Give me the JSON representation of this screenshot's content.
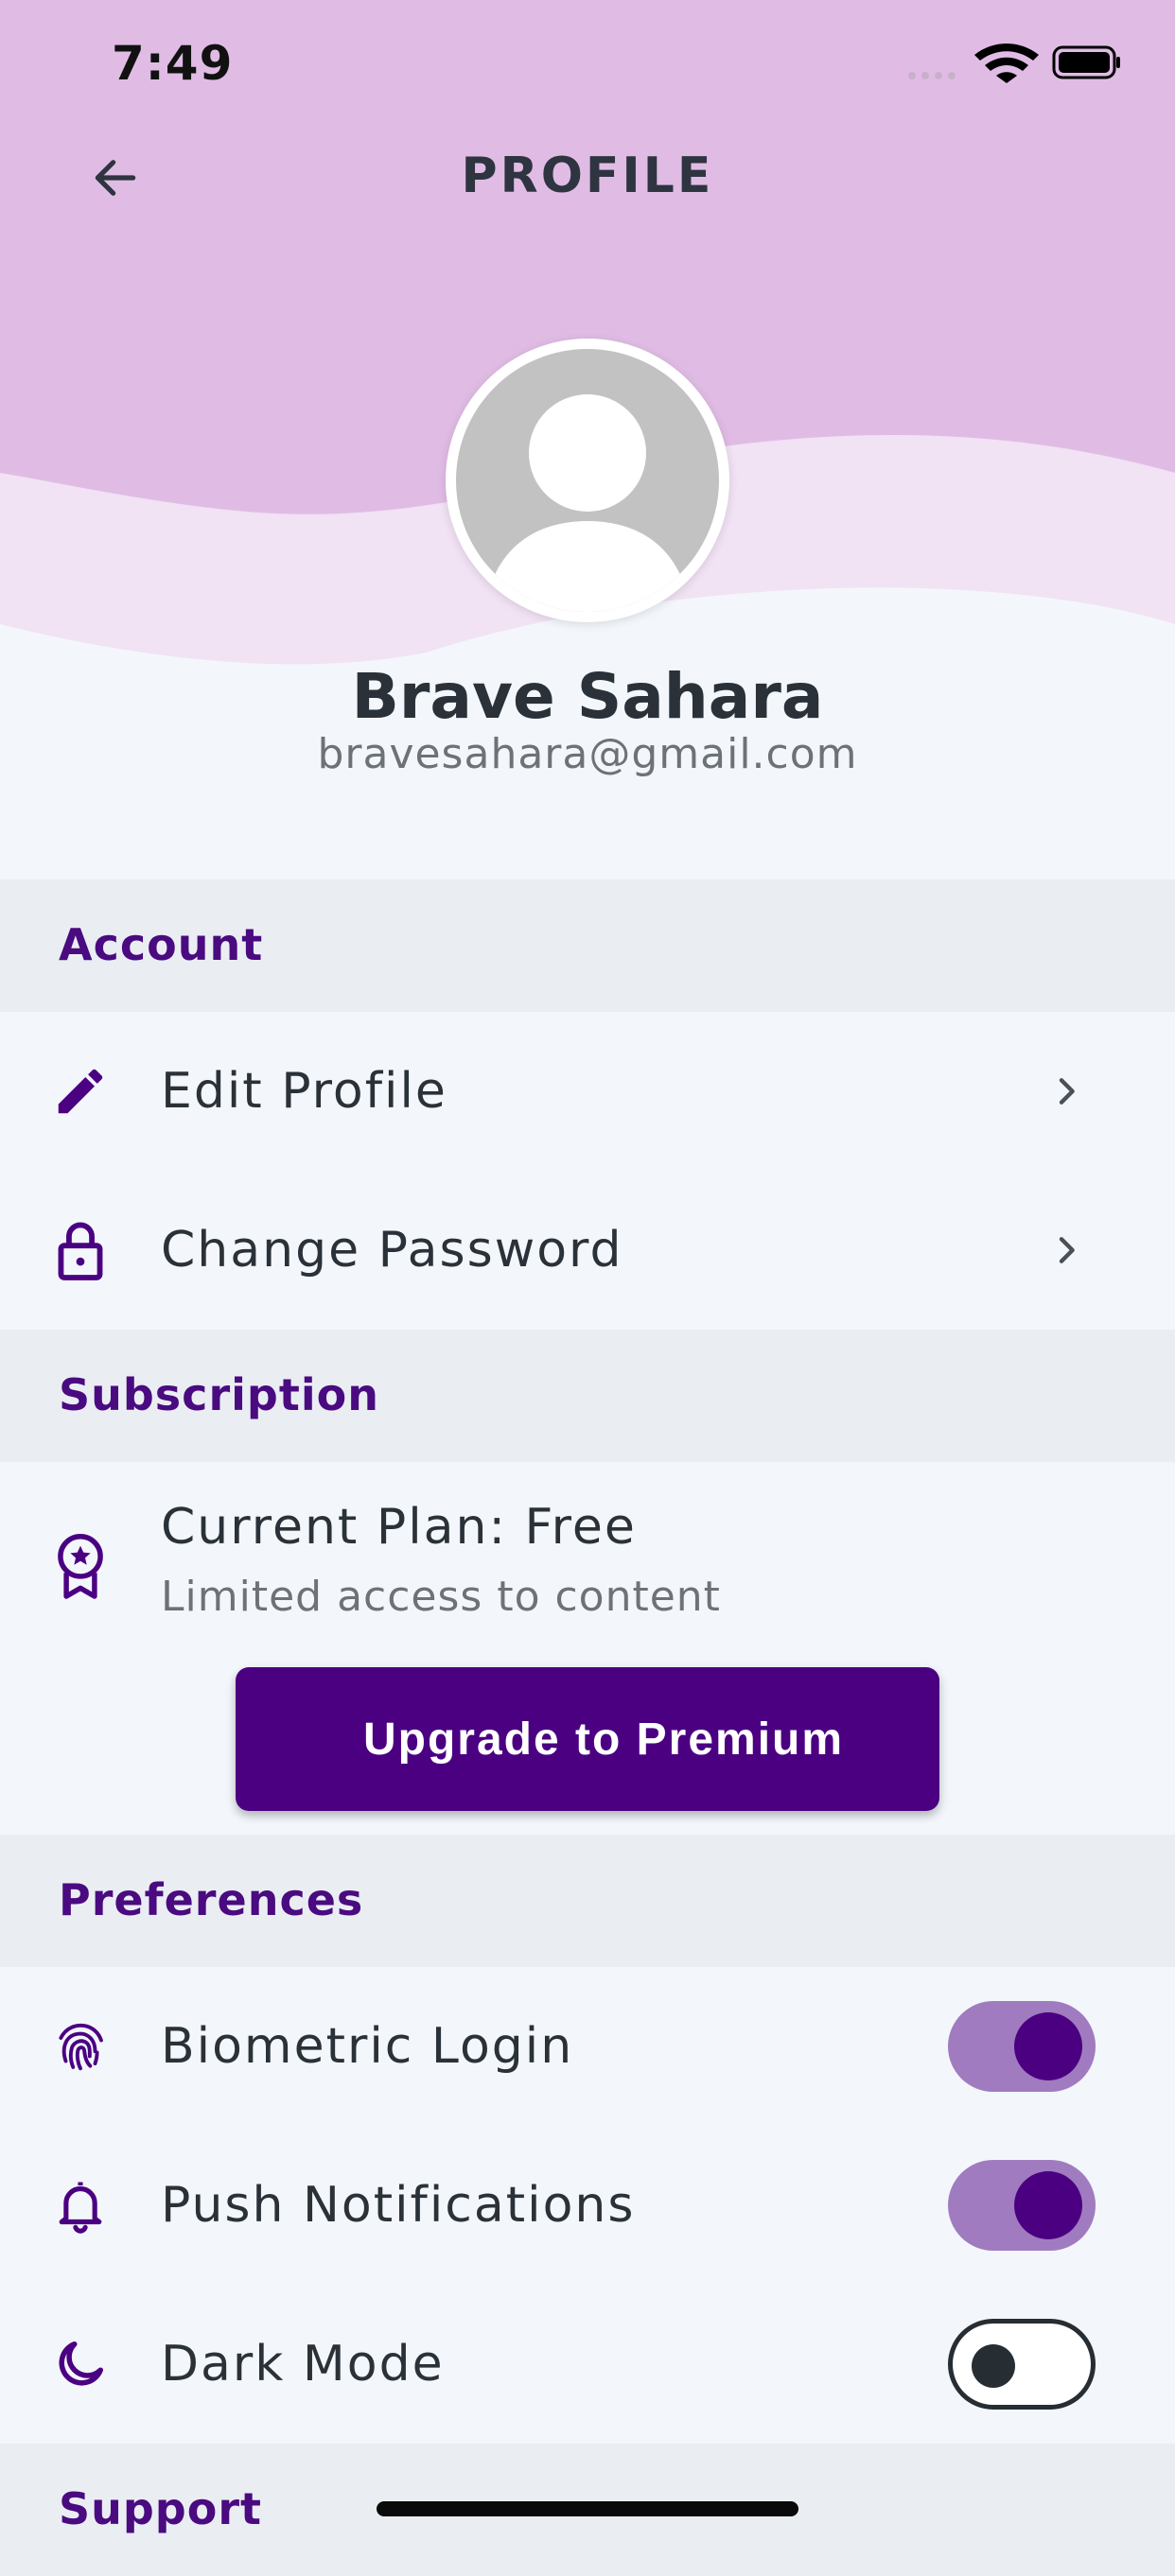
{
  "status_bar": {
    "time": "7:49"
  },
  "header": {
    "title": "PROFILE"
  },
  "profile": {
    "name": "Brave Sahara",
    "email": "bravesahara@gmail.com"
  },
  "sections": {
    "account": {
      "title": "Account",
      "items": [
        {
          "label": "Edit Profile",
          "icon": "pencil-icon"
        },
        {
          "label": "Change Password",
          "icon": "lock-icon"
        }
      ]
    },
    "subscription": {
      "title": "Subscription",
      "plan_title": "Current Plan: Free",
      "plan_subtitle": "Limited access to content",
      "upgrade_label": "Upgrade to Premium"
    },
    "preferences": {
      "title": "Preferences",
      "items": [
        {
          "label": "Biometric Login",
          "icon": "fingerprint-icon",
          "enabled": true
        },
        {
          "label": "Push Notifications",
          "icon": "bell-icon",
          "enabled": true
        },
        {
          "label": "Dark Mode",
          "icon": "moon-icon",
          "enabled": false
        }
      ]
    },
    "support": {
      "title": "Support"
    }
  },
  "colors": {
    "accent": "#4b0082",
    "header_wave_dark": "#e0bce5",
    "header_wave_light": "#f1e2f4",
    "background": "#f3f7fb",
    "section_bg": "#eaeef3"
  }
}
